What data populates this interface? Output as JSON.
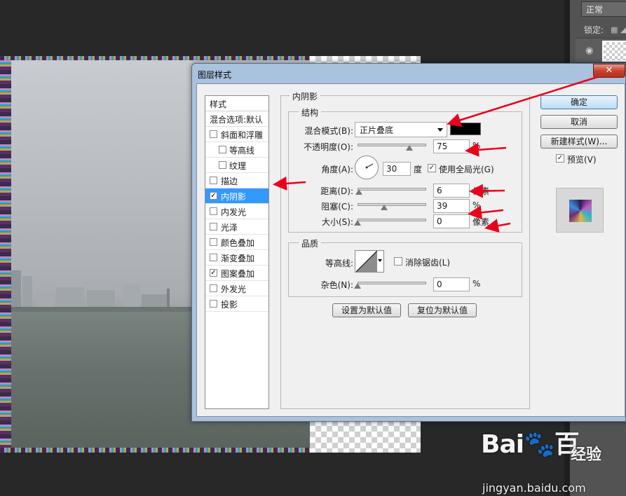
{
  "colors": {
    "workspace_bg": "#282828",
    "list_selected": "#3399ff",
    "annotation": "#e8001c",
    "shadow_color_swatch": "#000000"
  },
  "layers_panel": {
    "blend_mode": "正常",
    "lock_label": "锁定:",
    "lock_icons": "▦ ◢"
  },
  "dialog": {
    "title": "图层样式",
    "close_label": "✕",
    "style_list": {
      "header": "样式",
      "items": [
        {
          "label": "混合选项:默认",
          "checkbox": false,
          "checked": false,
          "indent": false,
          "selected": false
        },
        {
          "label": "斜面和浮雕",
          "checkbox": true,
          "checked": false,
          "indent": false,
          "selected": false
        },
        {
          "label": "等高线",
          "checkbox": true,
          "checked": false,
          "indent": true,
          "selected": false
        },
        {
          "label": "纹理",
          "checkbox": true,
          "checked": false,
          "indent": true,
          "selected": false
        },
        {
          "label": "描边",
          "checkbox": true,
          "checked": false,
          "indent": false,
          "selected": false
        },
        {
          "label": "内阴影",
          "checkbox": true,
          "checked": true,
          "indent": false,
          "selected": true
        },
        {
          "label": "内发光",
          "checkbox": true,
          "checked": false,
          "indent": false,
          "selected": false
        },
        {
          "label": "光泽",
          "checkbox": true,
          "checked": false,
          "indent": false,
          "selected": false
        },
        {
          "label": "颜色叠加",
          "checkbox": true,
          "checked": false,
          "indent": false,
          "selected": false
        },
        {
          "label": "渐变叠加",
          "checkbox": true,
          "checked": false,
          "indent": false,
          "selected": false
        },
        {
          "label": "图案叠加",
          "checkbox": true,
          "checked": true,
          "indent": false,
          "selected": false
        },
        {
          "label": "外发光",
          "checkbox": true,
          "checked": false,
          "indent": false,
          "selected": false
        },
        {
          "label": "投影",
          "checkbox": true,
          "checked": false,
          "indent": false,
          "selected": false
        }
      ]
    },
    "main": {
      "section_title": "内阴影",
      "structure": {
        "legend": "结构",
        "blend_mode_label": "混合模式(B):",
        "blend_mode_value": "正片叠底",
        "opacity_label": "不透明度(O):",
        "opacity_value": "75",
        "opacity_unit": "%",
        "opacity_fraction": 0.75,
        "angle_label": "角度(A):",
        "angle_value": "30",
        "angle_unit": "度",
        "global_light_label": "使用全局光(G)",
        "global_light_checked": true,
        "distance_label": "距离(D):",
        "distance_value": "6",
        "distance_unit": "像素",
        "distance_fraction": 0.02,
        "choke_label": "阻塞(C):",
        "choke_value": "39",
        "choke_unit": "%",
        "choke_fraction": 0.39,
        "size_label": "大小(S):",
        "size_value": "0",
        "size_unit": "像素",
        "size_fraction": 0.0
      },
      "quality": {
        "legend": "品质",
        "contour_label": "等高线:",
        "antialias_label": "消除锯齿(L)",
        "antialias_checked": false,
        "noise_label": "杂色(N):",
        "noise_value": "0",
        "noise_unit": "%",
        "noise_fraction": 0.0
      },
      "make_default_label": "设置为默认值",
      "reset_default_label": "复位为默认值"
    },
    "buttons": {
      "ok": "确定",
      "cancel": "取消",
      "new_style": "新建样式(W)...",
      "preview_label": "预览(V)",
      "preview_checked": true
    }
  },
  "watermark": {
    "logo": "Bai",
    "logo_end": "百",
    "cn": "经验",
    "url": "jingyan.baidu.com"
  }
}
